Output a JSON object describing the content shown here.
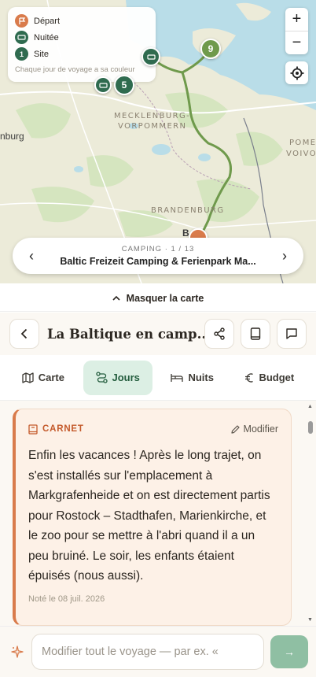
{
  "map": {
    "legend": {
      "items": [
        {
          "label": "Départ",
          "icon": "flag-icon",
          "color": "#d97b4b"
        },
        {
          "label": "Nuitée",
          "icon": "bed-icon",
          "color": "#2f6b4f"
        },
        {
          "label": "Site",
          "icon": "site-number-icon",
          "color": "#2f6b4f",
          "badge": "1"
        }
      ],
      "note": "Chaque jour de voyage a sa couleur"
    },
    "zoom_in": "+",
    "zoom_out": "−",
    "region_labels": [
      "MECKLENBURG-",
      "VORPOMMERN",
      "BRANDENBURG",
      "POME",
      "VOIVO"
    ],
    "city_label": "nburg",
    "city_label_2": "B",
    "pins": {
      "site_a": "9",
      "site_b": "5"
    },
    "camp_card": {
      "kicker": "CAMPING · 1 / 13",
      "name": "Baltic Freizeit Camping & Ferienpark Ma...",
      "prev": "‹",
      "next": "›"
    }
  },
  "hide_map": {
    "label": "Masquer la carte",
    "chevron": "^"
  },
  "header": {
    "title": "La Baltique en camp..."
  },
  "tabs": [
    {
      "label": "Carte",
      "icon": "map-icon",
      "active": false
    },
    {
      "label": "Jours",
      "icon": "route-icon",
      "active": true
    },
    {
      "label": "Nuits",
      "icon": "bed-icon",
      "active": false
    },
    {
      "label": "Budget",
      "icon": "euro-icon",
      "active": false
    }
  ],
  "note": {
    "kicker": "CARNET",
    "edit_label": "Modifier",
    "text": "Enfin les vacances ! Après le long trajet, on s'est installés sur l'emplacement à Markgrafenheide et on est directement partis pour Rostock – Stadthafen, Marienkirche, et le zoo pour se mettre à l'abri quand il a un peu bruiné. Le soir, les enfants étaient épuisés (nous aussi).",
    "date": "Noté le 08 juil. 2026"
  },
  "composer": {
    "placeholder": "Modifier tout le voyage — par ex. «",
    "send_icon": "→"
  },
  "colors": {
    "accent_orange": "#d97b4b",
    "accent_green": "#2f6b4f",
    "route_green": "#6f9a4c",
    "active_tab_bg": "#dcefe4"
  }
}
